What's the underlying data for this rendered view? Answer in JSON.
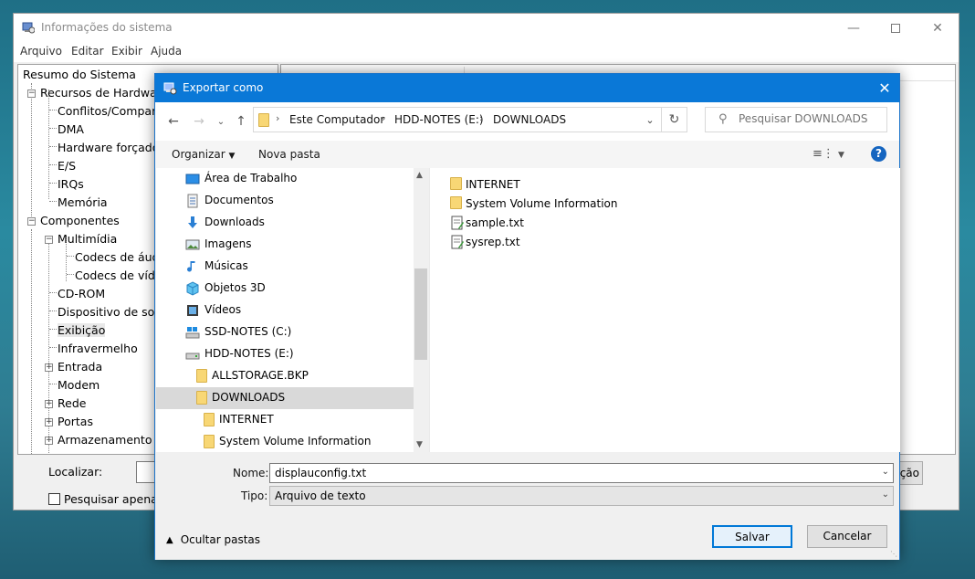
{
  "main": {
    "title": "Informações do sistema",
    "menu": [
      "Arquivo",
      "Editar",
      "Exibir",
      "Ajuda"
    ],
    "tree": [
      "Resumo do Sistema",
      "Recursos de Hardware",
      "Conflitos/Compartilhamento",
      "DMA",
      "Hardware forçado",
      "E/S",
      "IRQs",
      "Memória",
      "Componentes",
      "Multimídia",
      "Codecs de áudio",
      "Codecs de vídeo",
      "CD-ROM",
      "Dispositivo de som",
      "Exibição",
      "Infravermelho",
      "Entrada",
      "Modem",
      "Rede",
      "Portas",
      "Armazenamento"
    ],
    "find_label": "Localizar:",
    "find_checkbox": "Pesquisar apenas",
    "find_button_fragment": "ção"
  },
  "dialog": {
    "title": "Exportar como",
    "breadcrumb": [
      "Este Computador",
      "HDD-NOTES (E:)",
      "DOWNLOADS"
    ],
    "search_placeholder": "Pesquisar DOWNLOADS",
    "toolbar": {
      "organize": "Organizar",
      "new_folder": "Nova pasta",
      "help": "?"
    },
    "nav_items": [
      {
        "label": "Área de Trabalho",
        "icon": "desktop-icon"
      },
      {
        "label": "Documentos",
        "icon": "documents-icon"
      },
      {
        "label": "Downloads",
        "icon": "downloads-icon"
      },
      {
        "label": "Imagens",
        "icon": "pictures-icon"
      },
      {
        "label": "Músicas",
        "icon": "music-icon"
      },
      {
        "label": "Objetos 3D",
        "icon": "objects-3d-icon"
      },
      {
        "label": "Vídeos",
        "icon": "videos-icon"
      },
      {
        "label": "SSD-NOTES (C:)",
        "icon": "drive-c-icon"
      },
      {
        "label": "HDD-NOTES (E:)",
        "icon": "drive-e-icon"
      },
      {
        "label": "ALLSTORAGE.BKP",
        "icon": "folder-icon"
      },
      {
        "label": "DOWNLOADS",
        "icon": "folder-icon",
        "selected": true
      },
      {
        "label": "INTERNET",
        "icon": "folder-icon"
      },
      {
        "label": "System Volume Information",
        "icon": "folder-icon"
      }
    ],
    "files": [
      {
        "label": "INTERNET",
        "icon": "folder-icon"
      },
      {
        "label": "System Volume Information",
        "icon": "folder-icon"
      },
      {
        "label": "sample.txt",
        "icon": "text-file-icon"
      },
      {
        "label": "sysrep.txt",
        "icon": "text-file-icon"
      }
    ],
    "name_label": "Nome:",
    "name_value": "displauconfig.txt",
    "type_label": "Tipo:",
    "type_value": "Arquivo de texto",
    "hide_folders": "Ocultar pastas",
    "save": "Salvar",
    "cancel": "Cancelar"
  }
}
